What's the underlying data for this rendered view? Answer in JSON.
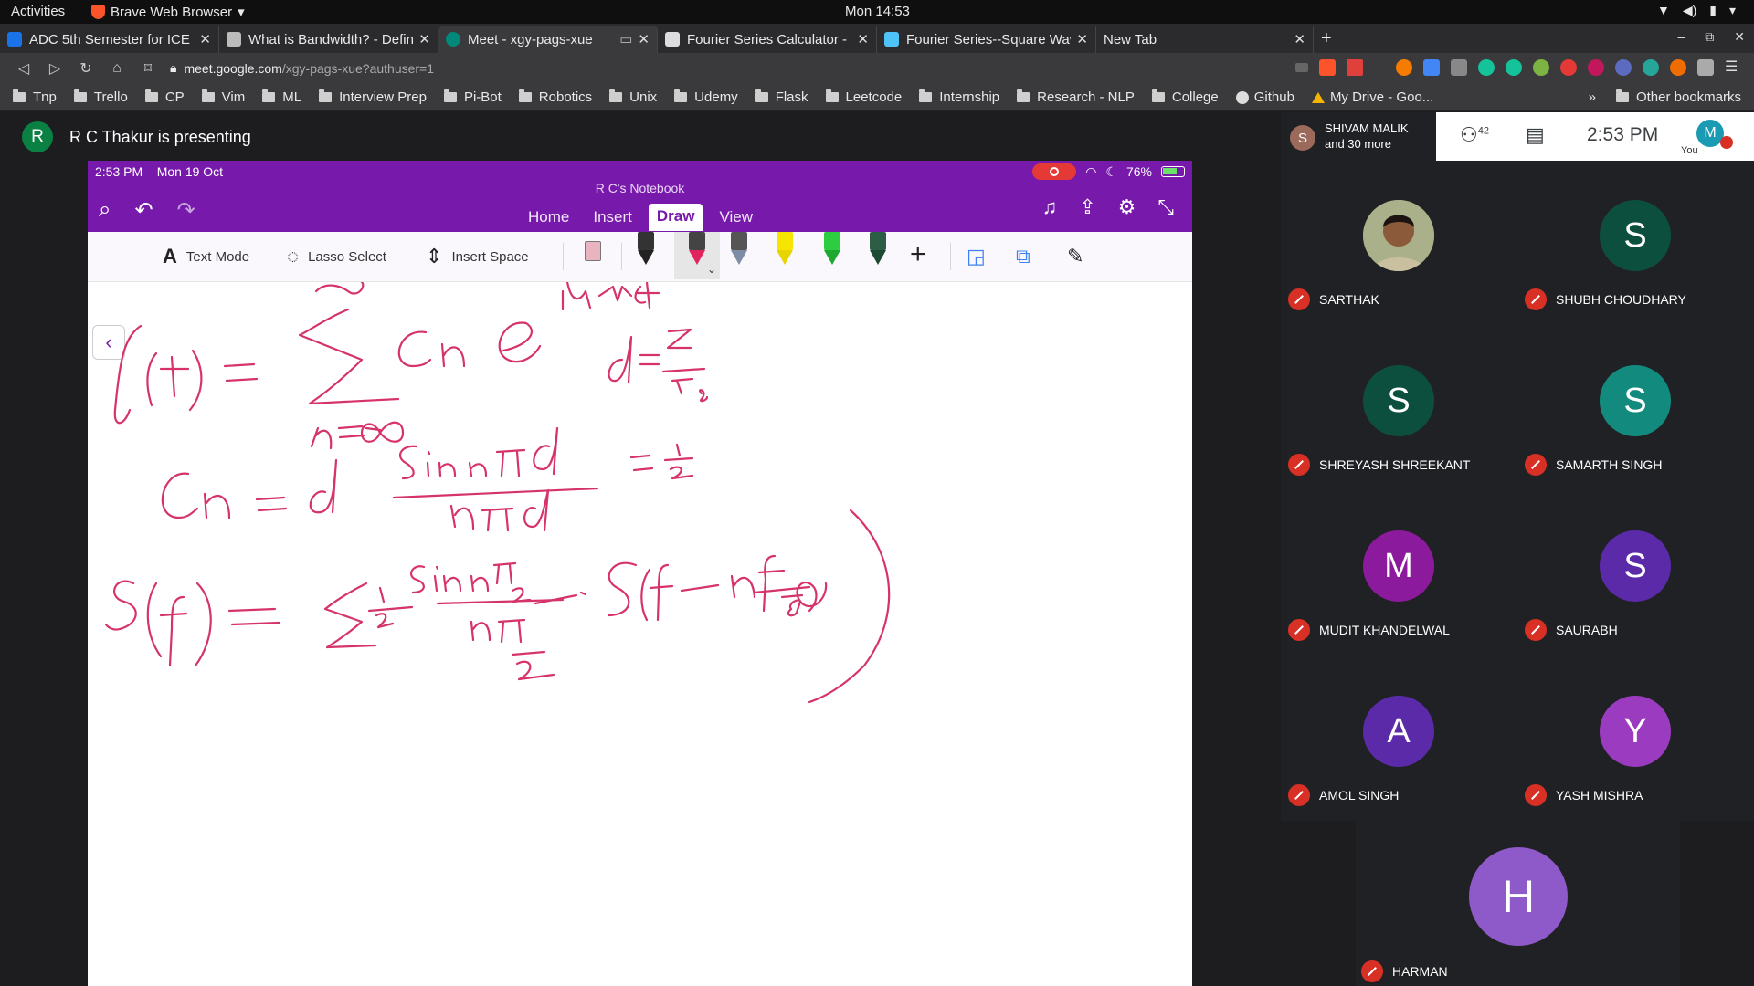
{
  "os": {
    "activities": "Activities",
    "app_name": "Brave Web Browser",
    "clock": "Mon 14:53"
  },
  "tabs": [
    {
      "title": "ADC 5th Semester for ICE y",
      "color": "#1a73e8"
    },
    {
      "title": "What is Bandwidth? - Defin",
      "color": "#bbbbbb"
    },
    {
      "title": "Meet - xgy-pags-xue",
      "color": "#00897b"
    },
    {
      "title": "Fourier Series Calculator - F",
      "color": "#dddddd"
    },
    {
      "title": "Fourier Series--Square Wav",
      "color": "#4fc3f7"
    },
    {
      "title": "New Tab",
      "color": "#2b2b2e"
    }
  ],
  "url": {
    "host": "meet.google.com",
    "path": "/xgy-pags-xue?authuser=1"
  },
  "bookmarks": [
    "Tnp",
    "Trello",
    "CP",
    "Vim",
    "ML",
    "Interview Prep",
    "Pi-Bot",
    "Robotics",
    "Unix",
    "Udemy",
    "Flask",
    "Leetcode",
    "Internship",
    "Research - NLP",
    "College",
    "Github",
    "My Drive - Goo..."
  ],
  "bookmarks_more": "»",
  "other_bookmarks": "Other bookmarks",
  "presenter": {
    "initial": "R",
    "text": "R C Thakur is presenting"
  },
  "ipad": {
    "time": "2:53 PM",
    "date": "Mon 19 Oct",
    "battery": "76%",
    "notebook": "R C's Notebook",
    "menu": [
      "Home",
      "Insert",
      "Draw",
      "View"
    ],
    "selected_menu": "Draw",
    "tools": {
      "text_mode": "Text Mode",
      "lasso": "Lasso Select",
      "insert_space": "Insert Space"
    }
  },
  "call": {
    "presenting_initial": "S",
    "presenting_name": "SHIVAM MALIK",
    "presenting_more": "and 30 more",
    "people_count": "42",
    "time": "2:53 PM",
    "you_initial": "M",
    "you_label": "You"
  },
  "participants": [
    {
      "name": "SARTHAK",
      "initial": "",
      "color": "#8a6d4e"
    },
    {
      "name": "SHUBH CHOUDHARY",
      "initial": "S",
      "color": "#0d4f3f"
    },
    {
      "name": "SHREYASH SHREEKANT",
      "initial": "S",
      "color": "#0d4f3f"
    },
    {
      "name": "SAMARTH SINGH",
      "initial": "S",
      "color": "#128a7e"
    },
    {
      "name": "MUDIT KHANDELWAL",
      "initial": "M",
      "color": "#8c1a9c"
    },
    {
      "name": "SAURABH",
      "initial": "S",
      "color": "#5b2aa8"
    },
    {
      "name": "AMOL SINGH",
      "initial": "A",
      "color": "#5b2aa8"
    },
    {
      "name": "YASH MISHRA",
      "initial": "Y",
      "color": "#9b3bc0"
    }
  ],
  "harman": {
    "name": "HARMAN",
    "initial": "H",
    "color": "#8e59c8"
  }
}
